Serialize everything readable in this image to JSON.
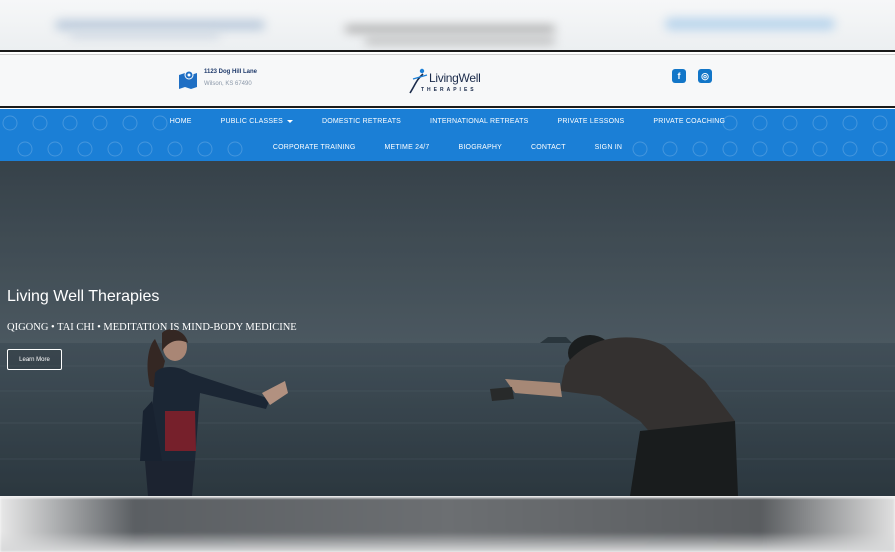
{
  "header": {
    "address_line1": "1123 Dog Hill Lane",
    "address_line2": "Wilson, KS 67490",
    "logo_text": "LivingWell",
    "logo_subtext": "THERAPIES",
    "social": [
      {
        "name": "facebook",
        "glyph": "f"
      },
      {
        "name": "instagram",
        "glyph": "◎"
      }
    ]
  },
  "nav": {
    "row1": [
      "HOME",
      "PUBLIC CLASSES",
      "DOMESTIC RETREATS",
      "INTERNATIONAL RETREATS",
      "PRIVATE LESSONS",
      "PRIVATE COACHING"
    ],
    "row2": [
      "CORPORATE TRAINING",
      "METIME 24/7",
      "BIOGRAPHY",
      "CONTACT",
      "SIGN IN"
    ]
  },
  "hero": {
    "title": "Living Well Therapies",
    "subtitle": "QIGONG • TAI CHI • MEDITATION IS MIND-BODY MEDICINE",
    "button_label": "Learn More"
  },
  "colors": {
    "nav_bg": "#1b7fd6",
    "brand_dark": "#1b2b4b",
    "accent": "#1276c8"
  }
}
